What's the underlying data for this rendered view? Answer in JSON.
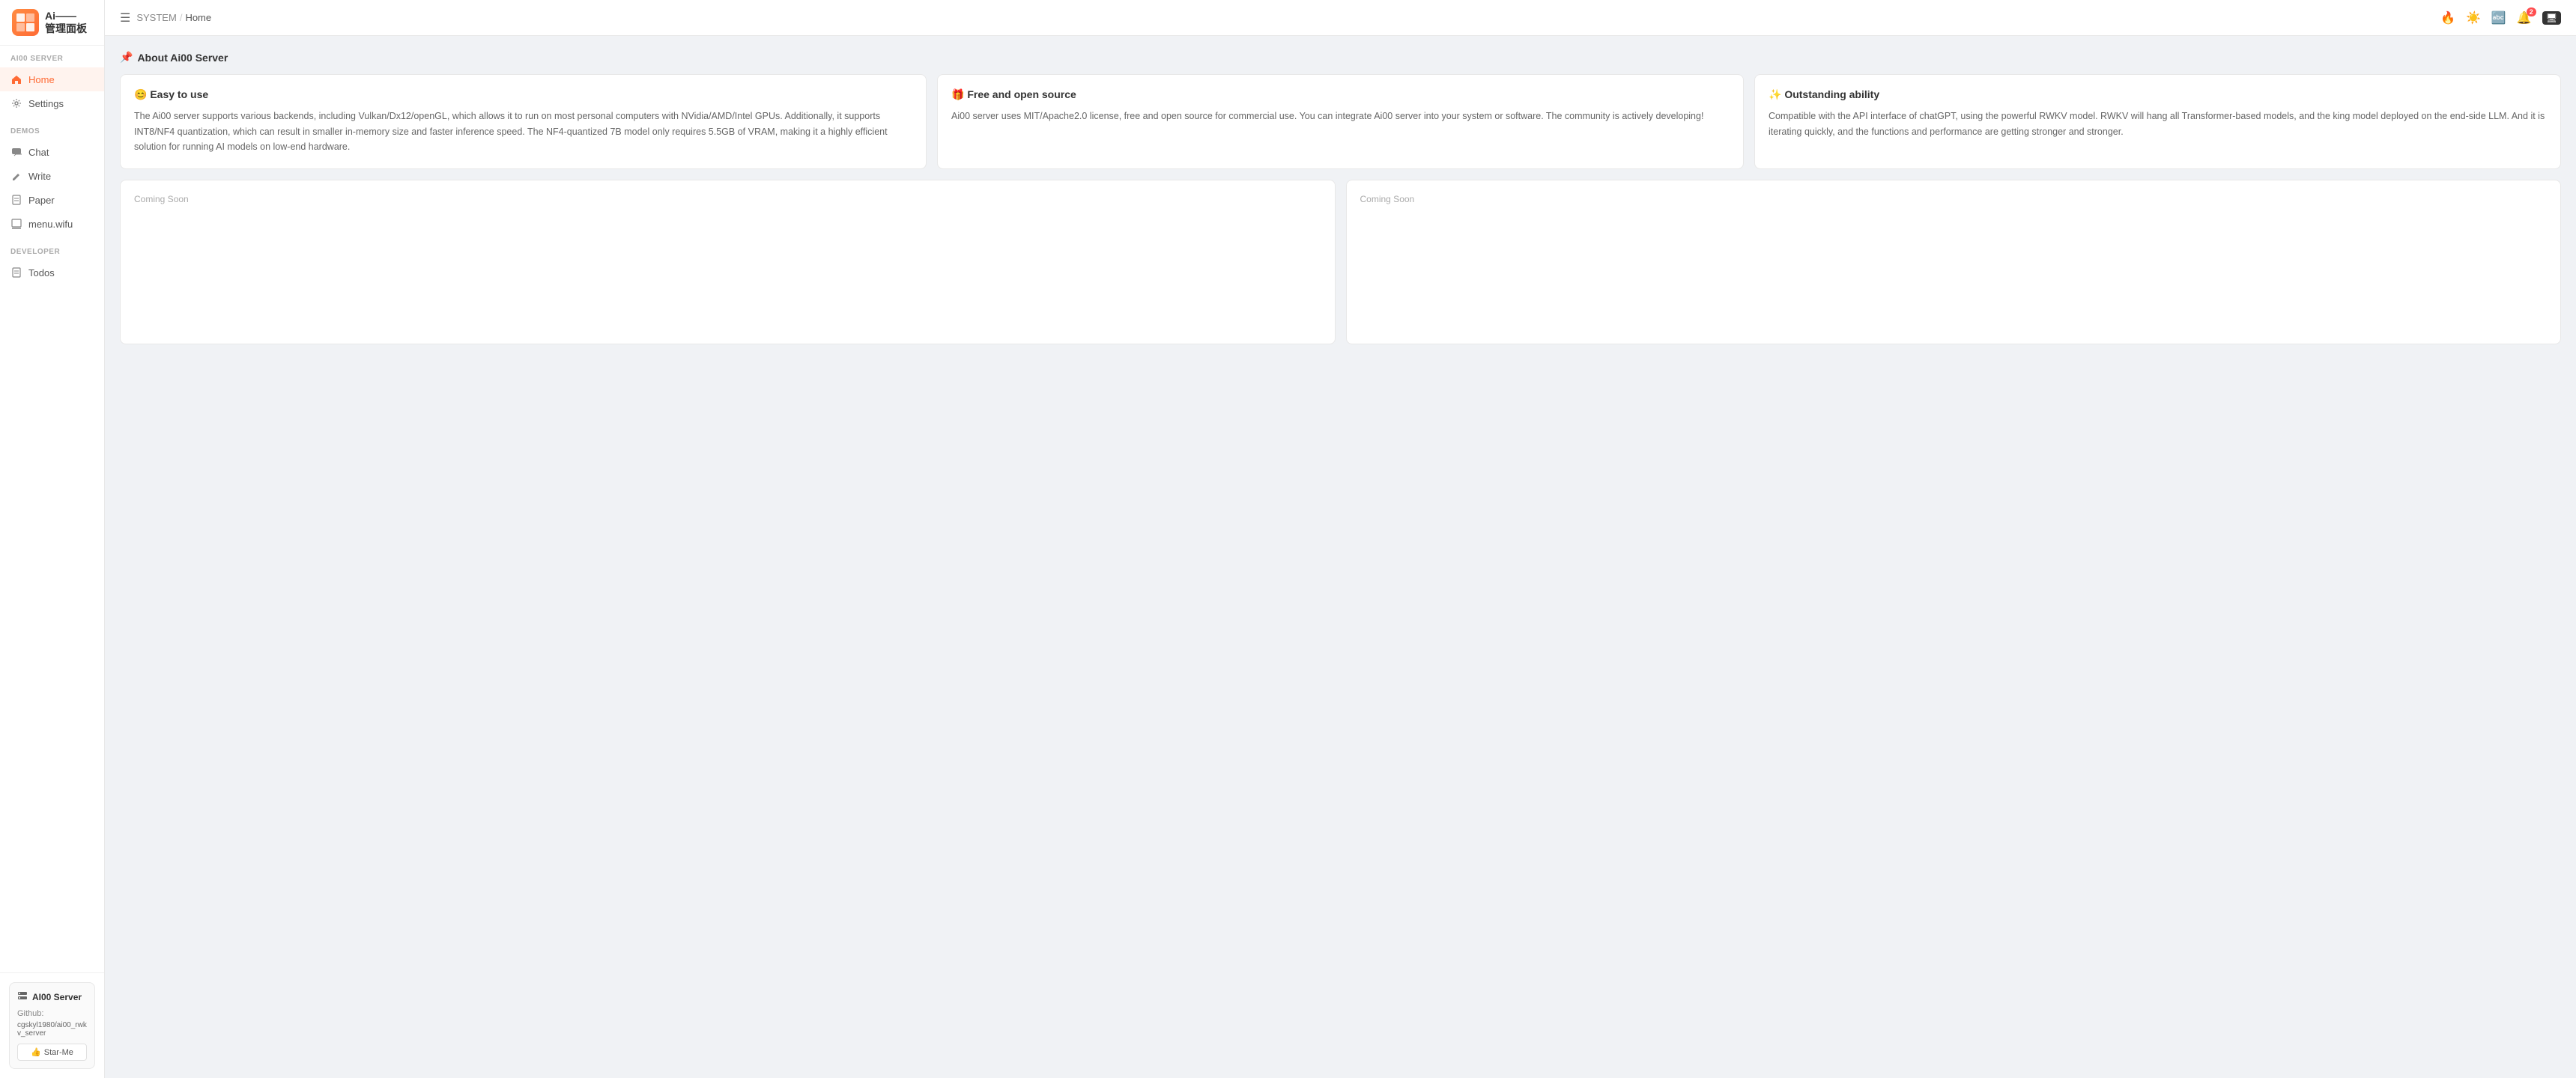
{
  "logo": {
    "icon_text": "Ai—",
    "title_line1": "Ai——",
    "title_line2": "管理面板"
  },
  "sidebar": {
    "sections": [
      {
        "label": "AI00 SERVER",
        "items": [
          {
            "id": "home",
            "label": "Home",
            "icon": "🏠",
            "active": true
          },
          {
            "id": "settings",
            "label": "Settings",
            "icon": "⚙️",
            "active": false
          }
        ]
      },
      {
        "label": "DEMOS",
        "items": [
          {
            "id": "chat",
            "label": "Chat",
            "icon": "💬",
            "active": false
          },
          {
            "id": "write",
            "label": "Write",
            "icon": "✏️",
            "active": false
          },
          {
            "id": "paper",
            "label": "Paper",
            "icon": "📄",
            "active": false
          },
          {
            "id": "menu-wifu",
            "label": "menu.wifu",
            "icon": "🖥️",
            "active": false
          }
        ]
      },
      {
        "label": "DEVELOPER",
        "items": [
          {
            "id": "todos",
            "label": "Todos",
            "icon": "📋",
            "active": false
          }
        ]
      }
    ],
    "bottom_card": {
      "title": "AI00 Server",
      "github_label": "Github:",
      "github_link": "cgskyl1980/ai00_rwkv_server",
      "star_label": "Star-Me"
    }
  },
  "topbar": {
    "breadcrumb_system": "SYSTEM",
    "breadcrumb_sep": "/",
    "breadcrumb_home": "Home",
    "icons": {
      "fire": "🔥",
      "sun": "☀️",
      "translate": "🔤",
      "bell": "🔔",
      "bell_badge": "2",
      "monitor": "🖥"
    }
  },
  "main": {
    "about_icon": "📌",
    "about_title": "About Ai00 Server",
    "cards": [
      {
        "icon": "😊",
        "title": "Easy to use",
        "body": "The Ai00 server supports various backends, including Vulkan/Dx12/openGL, which allows it to run on most personal computers with NVidia/AMD/Intel GPUs. Additionally, it supports INT8/NF4 quantization, which can result in smaller in-memory size and faster inference speed. The NF4-quantized 7B model only requires 5.5GB of VRAM, making it a highly efficient solution for running AI models on low-end hardware."
      },
      {
        "icon": "🎁",
        "title": "Free and open source",
        "body": "Ai00 server uses MIT/Apache2.0 license, free and open source for commercial use. You can integrate Ai00 server into your system or software. The community is actively developing!"
      },
      {
        "icon": "✨",
        "title": "Outstanding ability",
        "body": "Compatible with the API interface of chatGPT, using the powerful RWKV model. RWKV will hang all Transformer-based models, and the king model deployed on the end-side LLM. And it is iterating quickly, and the functions and performance are getting stronger and stronger."
      }
    ],
    "coming_soon_label": "Coming Soon"
  }
}
